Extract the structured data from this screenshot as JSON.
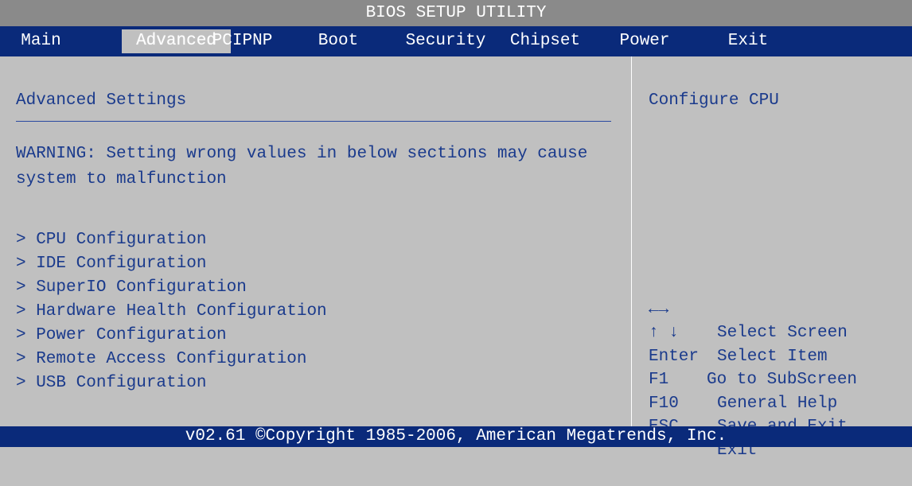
{
  "window": {
    "title": "BIOS SETUP UTILITY"
  },
  "tabs": [
    {
      "label": "Main"
    },
    {
      "label": "Advanced"
    },
    {
      "label": "PCIPNP"
    },
    {
      "label": "Boot"
    },
    {
      "label": "Security"
    },
    {
      "label": "Chipset"
    },
    {
      "label": "Power"
    },
    {
      "label": "Exit"
    }
  ],
  "active_tab": "Advanced",
  "main": {
    "heading": "Advanced Settings",
    "warning": "WARNING: Setting wrong values in below sections may cause system to malfunction",
    "menu_items": [
      {
        "label": "> CPU Configuration"
      },
      {
        "label": "> IDE Configuration"
      },
      {
        "label": "> SuperIO Configuration"
      },
      {
        "label": "> Hardware Health Configuration"
      },
      {
        "label": "> Power Configuration"
      },
      {
        "label": "> Remote Access Configuration"
      },
      {
        "label": "> USB Configuration"
      }
    ]
  },
  "help": {
    "text": "Configure CPU",
    "keys": [
      {
        "key": "←→",
        "desc": "Select Screen"
      },
      {
        "key": "↑ ↓",
        "desc": "Select Item"
      },
      {
        "key": "Enter",
        "desc": "Go to SubScreen"
      },
      {
        "key": "F1",
        "desc": "General Help"
      },
      {
        "key": "F10",
        "desc": "Save and Exit"
      },
      {
        "key": "ESC",
        "desc": "Exit"
      }
    ]
  },
  "footer": {
    "text": "v02.61 ©Copyright 1985-2006, American Megatrends, Inc."
  },
  "colors": {
    "background": "#c0c0c0",
    "bar": "#0a2a7a",
    "text": "#1a3a8c",
    "title_bar": "#8a8a8a"
  }
}
